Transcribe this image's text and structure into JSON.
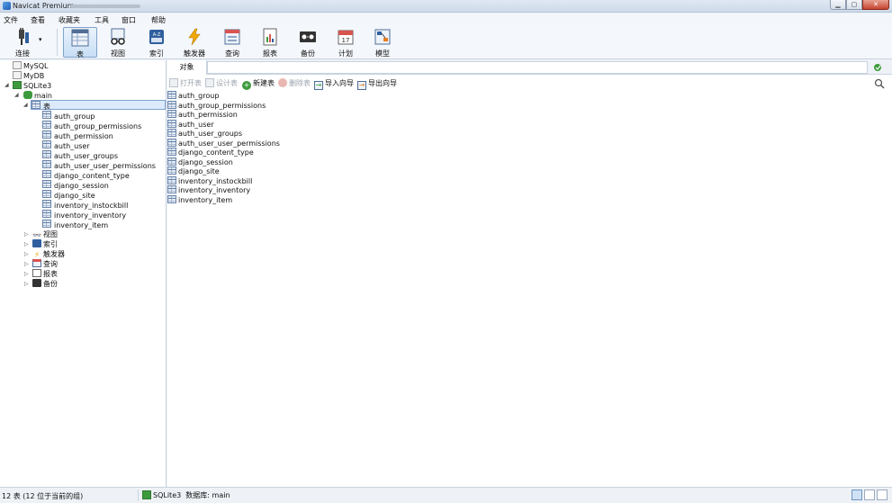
{
  "window": {
    "title": "Navicat Premium"
  },
  "menu": {
    "file": "文件",
    "view": "查看",
    "favorites": "收藏夹",
    "tools": "工具",
    "window": "窗口",
    "help": "帮助"
  },
  "toolbar": {
    "connect": "连接",
    "table": "表",
    "view": "视图",
    "index": "索引",
    "trigger": "触发器",
    "query": "查询",
    "report": "报表",
    "backup": "备份",
    "schedule": "计划",
    "model": "模型"
  },
  "tree": {
    "connections": [
      "MySQL",
      "MyDB",
      "SQLite3"
    ],
    "database": "main",
    "tables_node": "表",
    "tables": [
      "auth_group",
      "auth_group_permissions",
      "auth_permission",
      "auth_user",
      "auth_user_groups",
      "auth_user_user_permissions",
      "django_content_type",
      "django_session",
      "django_site",
      "inventory_instockbill",
      "inventory_inventory",
      "inventory_item"
    ],
    "other_nodes": [
      "视图",
      "索引",
      "触发器",
      "查询",
      "报表",
      "备份"
    ]
  },
  "objects_tab": "对象",
  "objects_toolbar": {
    "open": "打开表",
    "design": "设计表",
    "new": "新建表",
    "delete": "删除表",
    "import": "导入向导",
    "export": "导出向导"
  },
  "objects": [
    "auth_group",
    "auth_group_permissions",
    "auth_permission",
    "auth_user",
    "auth_user_groups",
    "auth_user_user_permissions",
    "django_content_type",
    "django_session",
    "django_site",
    "inventory_instockbill",
    "inventory_inventory",
    "inventory_item"
  ],
  "status": {
    "count": "12 表 (12 位于当前的组)",
    "connection": "SQLite3",
    "database": "数据库: main"
  },
  "colors": {
    "accent": "#1d5fb3",
    "selection": "#dcebfc",
    "sqlite_green": "#3c9a3c"
  }
}
